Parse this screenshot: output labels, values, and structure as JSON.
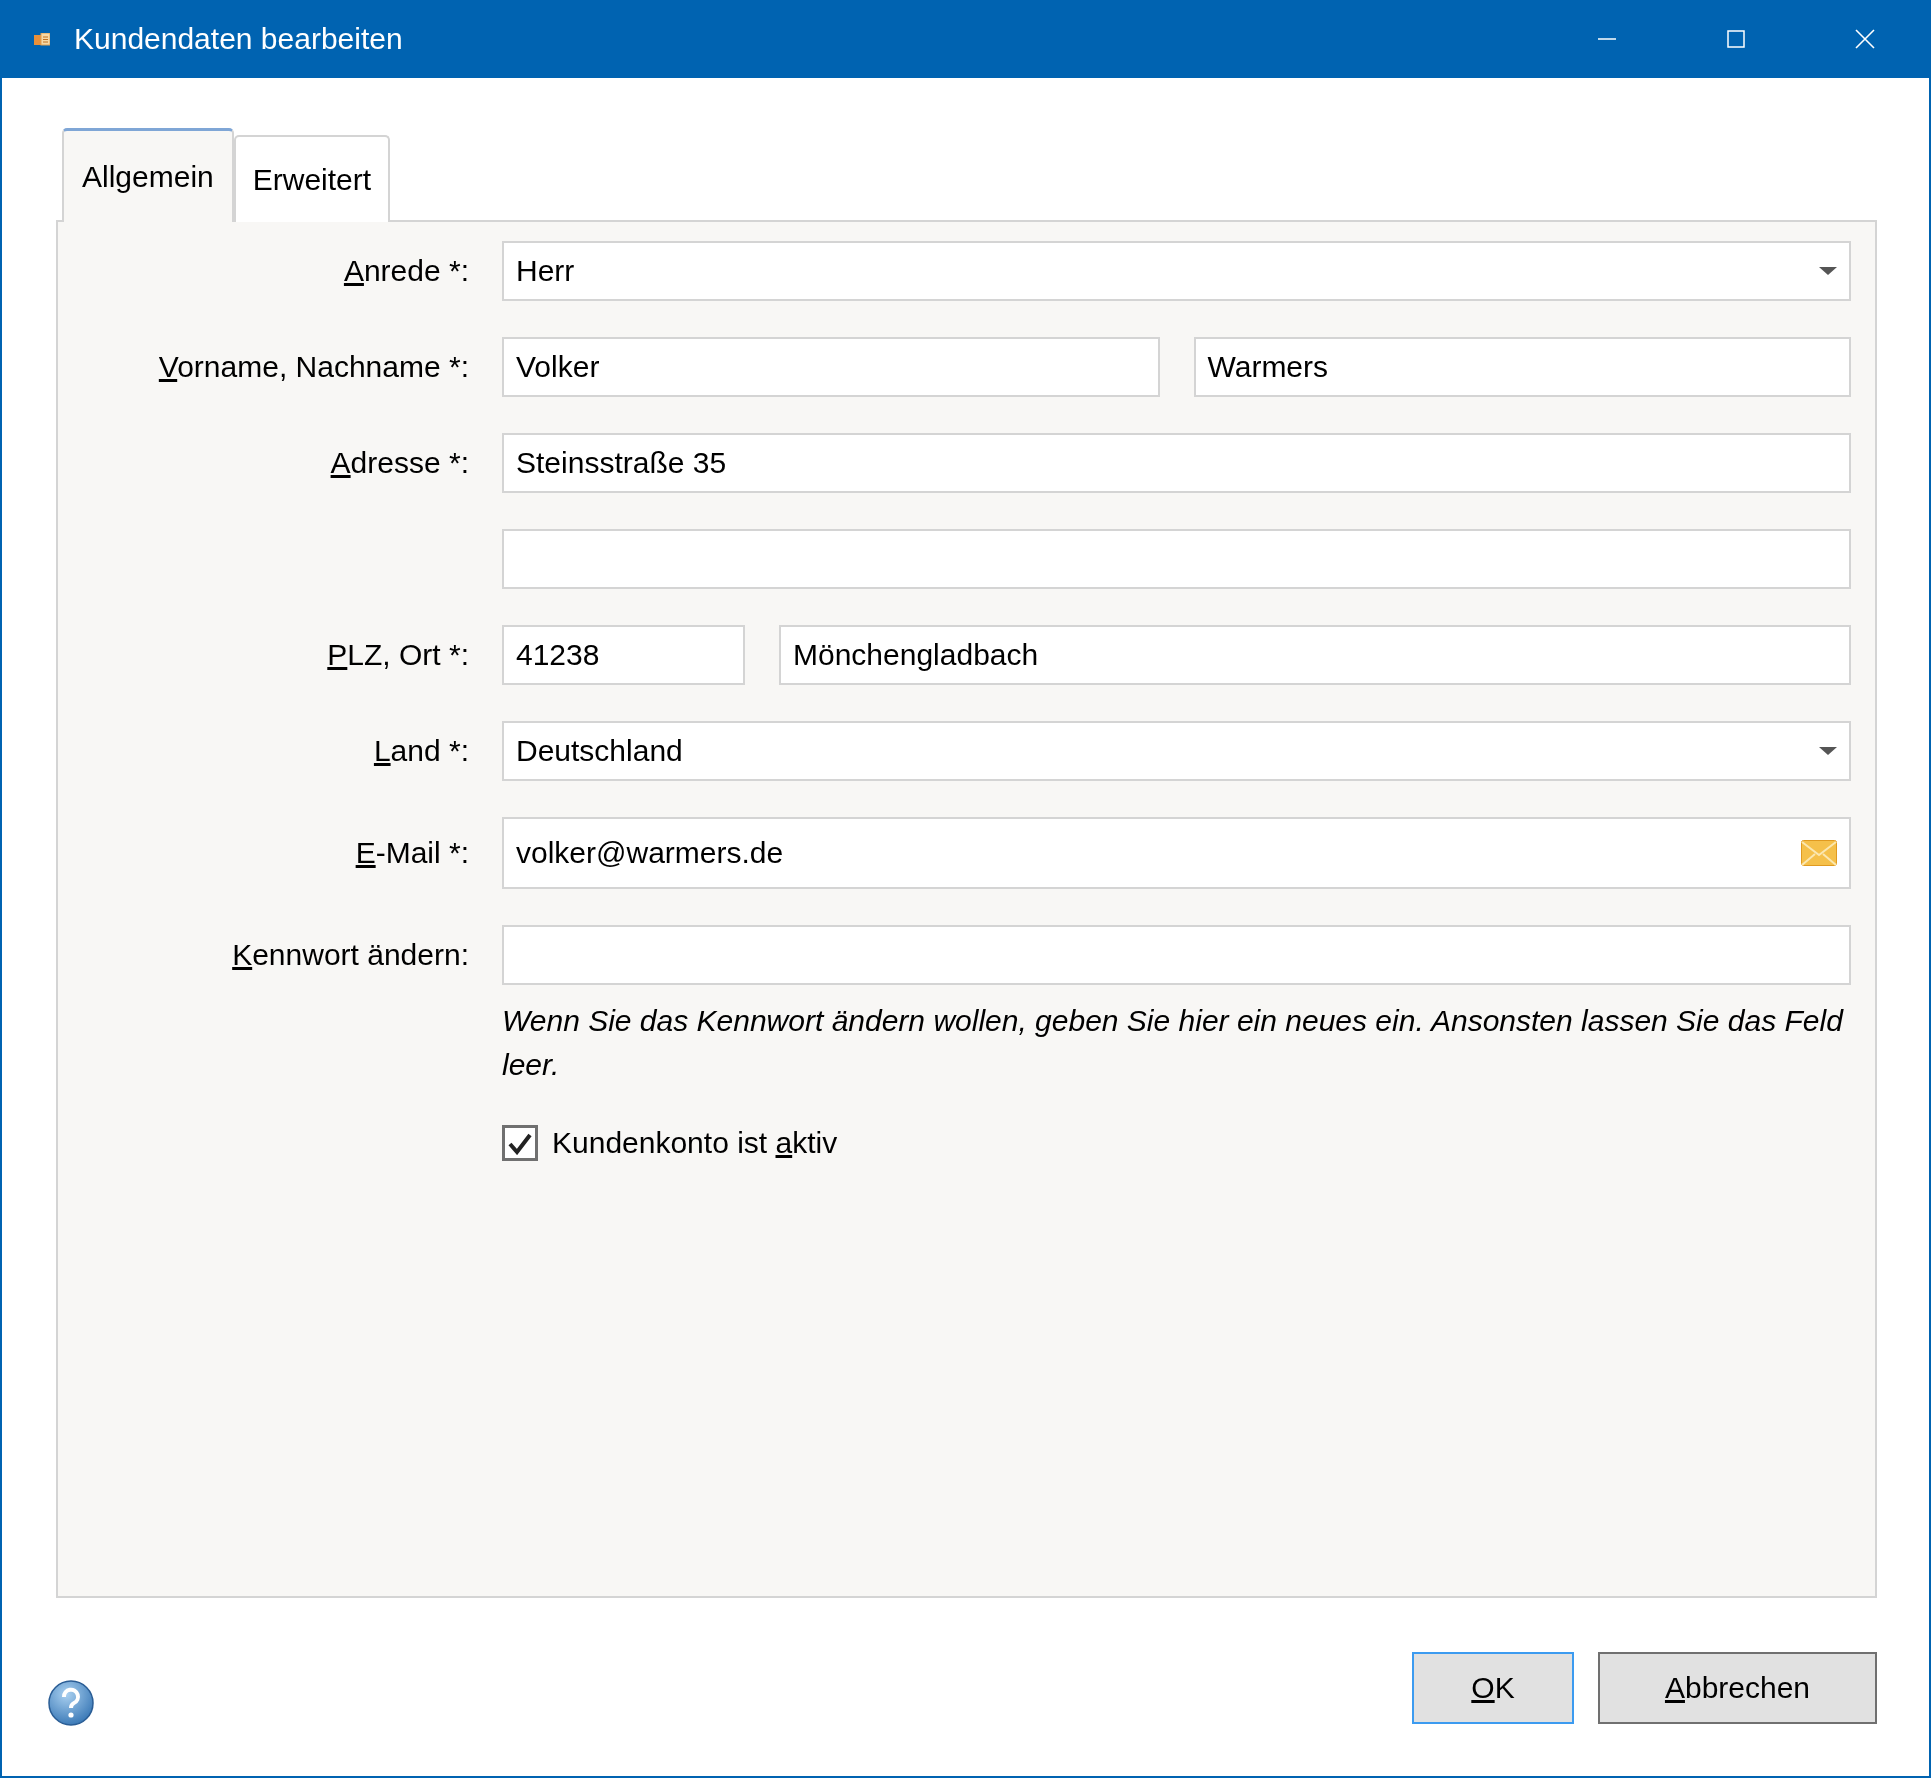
{
  "window": {
    "title": "Kundendaten bearbeiten"
  },
  "tabs": [
    {
      "label": "Allgemein",
      "selected": true
    },
    {
      "label": "Erweitert",
      "selected": false
    }
  ],
  "form": {
    "rows": [
      {
        "kind": "dropdown",
        "label": {
          "key": "A",
          "post": "nrede *:"
        },
        "fields": [
          {
            "value": "Herr"
          }
        ]
      },
      {
        "kind": "pair",
        "label": {
          "key": "V",
          "post": "orname, Nachname *:"
        },
        "fields": [
          {
            "value": "Volker"
          },
          {
            "value": "Warmers"
          }
        ]
      },
      {
        "kind": "text",
        "label": {
          "key": "A",
          "post": "dresse *:"
        },
        "fields": [
          {
            "value": "Steinsstraße 35"
          }
        ]
      },
      {
        "kind": "text"
      },
      {
        "kind": "zip-city",
        "label": {
          "key": "P",
          "post": "LZ, Ort *:"
        },
        "fields": [
          {
            "value": "41238"
          },
          {
            "value": "Mönchengladbach"
          }
        ]
      },
      {
        "kind": "dropdown",
        "label": {
          "key": "L",
          "post": "and *:"
        },
        "fields": [
          {
            "value": "Deutschland"
          }
        ]
      },
      {
        "kind": "email",
        "label": {
          "key": "E",
          "post": "-Mail *:"
        },
        "fields": [
          {
            "value": "volker@warmers.de"
          }
        ]
      },
      {
        "kind": "password",
        "label": {
          "key": "K",
          "post": "ennwort ändern:"
        }
      }
    ],
    "hint": "Wenn Sie das Kennwort ändern wollen, geben Sie hier ein neues ein. Ansonsten lassen Sie das Feld leer.",
    "checkbox": {
      "label": {
        "pre": "Kundenkonto ist ",
        "key": "a",
        "post": "ktiv"
      },
      "checked": true
    }
  },
  "buttons": [
    {
      "label": {
        "key": "O",
        "post": "K"
      },
      "default": true
    },
    {
      "label": {
        "key": "A",
        "post": "bbrechen"
      },
      "default": false
    }
  ]
}
